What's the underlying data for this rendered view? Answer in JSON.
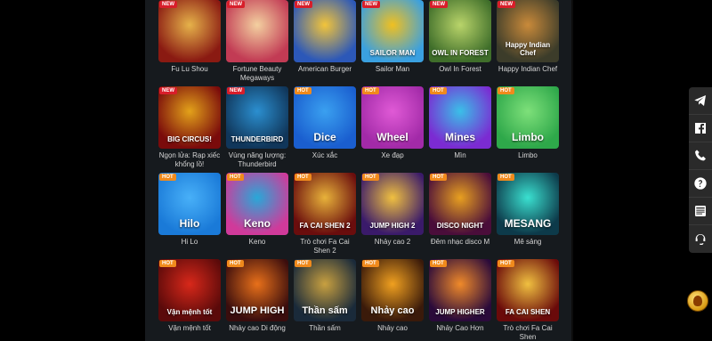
{
  "games": [
    {
      "name": "Fu Lu Shou",
      "badge": "NEW",
      "art": "",
      "c1": "#8a1a12",
      "c2": "#e6b24a"
    },
    {
      "name": "Fortune Beauty Megaways",
      "badge": "NEW",
      "art": "",
      "c1": "#c23b54",
      "c2": "#f3d0a0"
    },
    {
      "name": "American Burger",
      "badge": "NEW",
      "art": "",
      "c1": "#2c58b8",
      "c2": "#f2c43a"
    },
    {
      "name": "Sailor Man",
      "badge": "NEW",
      "art": "SAILOR MAN",
      "c1": "#3aa0e0",
      "c2": "#f0c020"
    },
    {
      "name": "Owl In Forest",
      "badge": "NEW",
      "art": "OWL IN FOREST",
      "c1": "#3f6e2a",
      "c2": "#b9d46a"
    },
    {
      "name": "Happy Indian Chef",
      "badge": "NEW",
      "art": "Happy Indian Chef",
      "c1": "#3c3c2a",
      "c2": "#c98a3a"
    },
    {
      "name": "Ngọn lửa: Rạp xiếc khổng lồ!",
      "badge": "NEW",
      "art": "BIG CIRCUS!",
      "c1": "#7a0b0b",
      "c2": "#e3a21a"
    },
    {
      "name": "Vùng năng lượng: Thunderbird",
      "badge": "NEW",
      "art": "THUNDERBIRD",
      "c1": "#10365a",
      "c2": "#2b8fd0"
    },
    {
      "name": "Xúc xắc",
      "badge": "HOT",
      "art": "Dice",
      "c1": "#1a5ecf",
      "c2": "#3aa0f0"
    },
    {
      "name": "Xe đạp",
      "badge": "HOT",
      "art": "Wheel",
      "c1": "#a22aa8",
      "c2": "#e05ad6"
    },
    {
      "name": "Mìn",
      "badge": "HOT",
      "art": "Mines",
      "c1": "#7b2bd2",
      "c2": "#3ac0e8"
    },
    {
      "name": "Limbo",
      "badge": "HOT",
      "art": "Limbo",
      "c1": "#2ea84a",
      "c2": "#7ee07a"
    },
    {
      "name": "Hi Lo",
      "badge": "HOT",
      "art": "Hilo",
      "c1": "#1a7ad8",
      "c2": "#48b0f8"
    },
    {
      "name": "Keno",
      "badge": "HOT",
      "art": "Keno",
      "c1": "#d03a9a",
      "c2": "#28a8d8"
    },
    {
      "name": "Trò chơi Fa Cai Shen 2",
      "badge": "HOT",
      "art": "FA CAI SHEN 2",
      "c1": "#6a0d0d",
      "c2": "#e8b23a"
    },
    {
      "name": "Nhảy cao 2",
      "badge": "HOT",
      "art": "JUMP HIGH 2",
      "c1": "#3a1a6a",
      "c2": "#f0c040"
    },
    {
      "name": "Đêm nhạc disco M",
      "badge": "HOT",
      "art": "DISCO NIGHT",
      "c1": "#4a0d3a",
      "c2": "#e8a020"
    },
    {
      "name": "Mê sảng",
      "badge": "HOT",
      "art": "MESANG",
      "c1": "#0d3a4a",
      "c2": "#3ae0d0"
    },
    {
      "name": "Vận mệnh tốt",
      "badge": "HOT",
      "art": "Vận mệnh tốt",
      "c1": "#5a0a0a",
      "c2": "#d8281a"
    },
    {
      "name": "Nhảy cao Di động",
      "badge": "HOT",
      "art": "JUMP HIGH",
      "c1": "#3a0d0d",
      "c2": "#e8701a"
    },
    {
      "name": "Thần sấm",
      "badge": "HOT",
      "art": "Thần sấm",
      "c1": "#1a2a3a",
      "c2": "#c8a040"
    },
    {
      "name": "Nhảy cao",
      "badge": "HOT",
      "art": "Nhảy cao",
      "c1": "#3a1a0a",
      "c2": "#f0a020"
    },
    {
      "name": "Nhảy Cao Hơn",
      "badge": "HOT",
      "art": "JUMP HIGHER",
      "c1": "#2a0a3a",
      "c2": "#f08a2a"
    },
    {
      "name": "Trò chơi Fa Cai Shen",
      "badge": "HOT",
      "art": "FA CAI SHEN",
      "c1": "#6a0a0a",
      "c2": "#f0c040"
    }
  ],
  "sidebar": [
    {
      "icon": "telegram-icon"
    },
    {
      "icon": "facebook-icon"
    },
    {
      "icon": "phone-icon"
    },
    {
      "icon": "help-icon"
    },
    {
      "icon": "news-icon"
    },
    {
      "icon": "support-icon"
    }
  ]
}
